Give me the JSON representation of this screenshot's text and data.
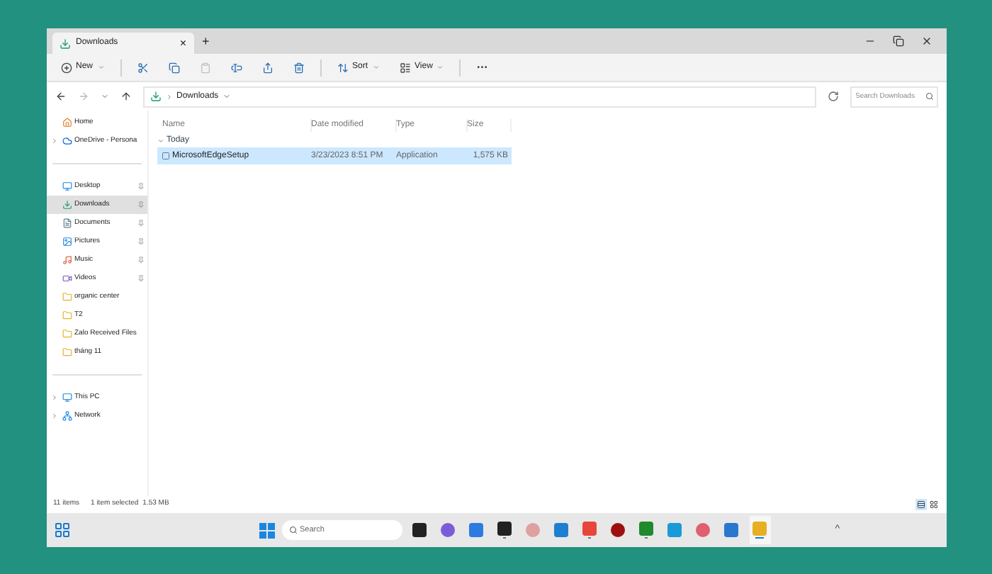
{
  "tab": {
    "title": "Downloads",
    "close": "×",
    "add": "+"
  },
  "toolbar": [
    {
      "label": "New",
      "menu": true,
      "disabled": false
    },
    {
      "disabled": false
    },
    {
      "disabled": false
    },
    {
      "disabled": true
    },
    {
      "disabled": false
    },
    {
      "disabled": false
    },
    {
      "disabled": false
    },
    {
      "label": "Sort",
      "menu": true,
      "disabled": false
    },
    {
      "label": "View",
      "menu": true,
      "disabled": false
    },
    {
      "label": "···",
      "disabled": false
    }
  ],
  "nav": {
    "forward_disabled": true
  },
  "address": {
    "path": "Downloads"
  },
  "search": {
    "placeholder": "Search Downloads"
  },
  "sidebar": [
    [
      {
        "label": "Home",
        "pinned": false,
        "selected": false
      },
      {
        "label": "OneDrive - Persona",
        "expanded": false,
        "pinned": false,
        "selected": false
      }
    ],
    [
      {
        "label": "Desktop",
        "pinned": true,
        "selected": false
      },
      {
        "label": "Downloads",
        "pinned": true,
        "selected": true
      },
      {
        "label": "Documents",
        "pinned": true,
        "selected": false
      },
      {
        "label": "Pictures",
        "pinned": true,
        "selected": false
      },
      {
        "label": "Music",
        "pinned": true,
        "selected": false
      },
      {
        "label": "Videos",
        "pinned": true,
        "selected": false
      },
      {
        "label": "organic center",
        "pinned": false,
        "selected": false
      },
      {
        "label": "T2",
        "pinned": false,
        "selected": false
      },
      {
        "label": "Zalo Received Files",
        "pinned": false,
        "selected": false
      },
      {
        "label": "tháng 11",
        "pinned": false,
        "selected": false
      }
    ],
    [
      {
        "label": "This PC",
        "expanded": false,
        "pinned": false,
        "selected": false
      },
      {
        "label": "Network",
        "expanded": false,
        "pinned": false,
        "selected": false
      }
    ]
  ],
  "table": {
    "columns": [
      "Name",
      "Date modified",
      "Type",
      "Size"
    ],
    "groups": [
      {
        "label": "Today",
        "expanded": true,
        "rows": [
          {
            "name": "MicrosoftEdgeSetup",
            "date": "3/23/2023 8:51 PM",
            "type": "Application",
            "size": "1,575 KB",
            "selected": true
          }
        ]
      }
    ]
  },
  "status_bar": {
    "count": "11 items",
    "selection": "1 item selected",
    "size": "1.53 MB",
    "views": [
      {
        "selected": true
      },
      {
        "selected": false
      }
    ]
  },
  "taskbar": {
    "search_placeholder": "Search",
    "apps": [
      {
        "running": false,
        "active": false
      },
      {
        "running": false,
        "active": false
      },
      {
        "running": false,
        "active": false
      },
      {
        "running": true,
        "active": false
      },
      {
        "running": false,
        "active": false
      },
      {
        "running": false,
        "active": false
      },
      {
        "running": true,
        "active": false
      },
      {
        "running": false,
        "active": false
      },
      {
        "running": true,
        "active": false
      },
      {
        "running": false,
        "active": false
      },
      {
        "running": false,
        "active": false
      },
      {
        "running": false,
        "active": false
      },
      {
        "running": true,
        "active": true
      }
    ],
    "overflow": "^"
  }
}
